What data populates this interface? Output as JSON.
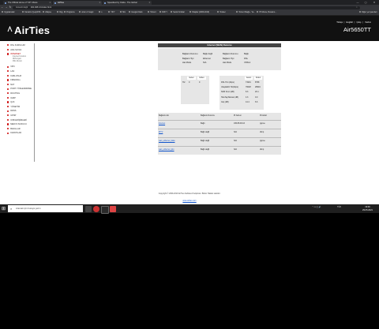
{
  "browser": {
    "tabs": [
      {
        "title": "The Official Home of YIFY Movie",
        "active": false
      },
      {
        "title": "AirTies",
        "active": true
      },
      {
        "title": "Speedtest by Ookla - The Global",
        "active": false
      }
    ],
    "window_controls": {
      "minimize": "—",
      "maximize": "▢",
      "close": "✕"
    },
    "address": {
      "security": "Güvenli değil",
      "url": "192.168.2.1/index.html"
    },
    "bookmarks": [
      "Uygulamalar",
      "Kanalım (Çeşitli Bil...",
      "Allapse",
      "Rpg",
      "Programs",
      "order of magic",
      "s",
      "YIFY",
      "Mix",
      "Google Kitabı",
      "Torrent",
      "DIZI Y",
      "Sezal Kırıkları",
      "Kitaplar (2006-2019)",
      "Toxdec",
      "Torrent Mağa - Ya...",
      "ITI Movie, Bunamo...",
      "Diğer yer işaretleri"
    ]
  },
  "header": {
    "logo": "AirTies",
    "links": [
      "Türkçe",
      "English",
      "Çıkış",
      "Yardım"
    ],
    "model": "Air5650TT"
  },
  "sidebar": {
    "items": [
      {
        "label": "DSL KURULUM",
        "active": false
      },
      {
        "label": "ANA SAYFA",
        "active": false
      },
      {
        "label": "INTERNET",
        "active": true,
        "subs": [
          "Internet Kurulum",
          "DNS Ayarl.",
          "DSL Durum"
        ]
      },
      {
        "label": "VPN",
        "active": false
      },
      {
        "label": "LAN",
        "active": false
      },
      {
        "label": "KABLOSUZ",
        "active": false
      },
      {
        "label": "FIREWALL",
        "active": false
      },
      {
        "label": "NAT",
        "active": false
      },
      {
        "label": "PORT YÖNLENDIRME",
        "active": false
      },
      {
        "label": "ROUTING",
        "active": false
      },
      {
        "label": "IGMP",
        "active": false
      },
      {
        "label": "QoS",
        "active": false
      },
      {
        "label": "YÖNETİM",
        "active": false
      },
      {
        "label": "DDNS",
        "active": false
      },
      {
        "label": "UPNP",
        "active": false
      },
      {
        "label": "USB ERİŞİMLERİ",
        "active": false
      },
      {
        "label": "MEDYA SUNUCU",
        "active": false
      },
      {
        "label": "BAKILLAR",
        "active": false
      },
      {
        "label": "KAPATILAR",
        "active": false
      }
    ]
  },
  "status": {
    "title": "Internet (WAN) Durumu",
    "left": [
      {
        "key": "Bağlantı Durumu",
        "value": "Bağlı değil"
      },
      {
        "key": "Bağlantı Tipi",
        "value": "Ethernet"
      },
      {
        "key": "Hat Modu",
        "value": "N/A"
      }
    ],
    "right": [
      {
        "key": "Bağlantı Durumu",
        "value": "Bağlı"
      },
      {
        "key": "Bağlantı Tipi",
        "value": "DSL"
      },
      {
        "key": "Hat Modu",
        "value": "VDSL2"
      }
    ]
  },
  "small_table": {
    "headers": [
      "Gelen",
      "Giden"
    ],
    "rows": [
      {
        "label": "Hız",
        "values": [
          "0",
          "0"
        ]
      }
    ]
  },
  "dsl_table": {
    "headers": [
      "Gelen",
      "Giden"
    ],
    "rows": [
      {
        "label": "DSL Hızı (kbps)",
        "values": [
          "71901",
          "8798"
        ]
      },
      {
        "label": "Ulaşılabilir Hız(kbps)",
        "values": [
          "76628",
          "28994"
        ]
      },
      {
        "label": "SNR Sınırı (dB)",
        "values": [
          "8.3",
          "29.1"
        ]
      },
      {
        "label": "Hat Zayıflaması (dB)",
        "values": [
          "4.3",
          "0.0"
        ]
      },
      {
        "label": "Güç (dB)",
        "values": [
          "14.4",
          "6.6"
        ]
      }
    ]
  },
  "connections": {
    "headers": [
      "Bağlantı Adı",
      "Bağlantı Durumu",
      "IP Adresi",
      "Protokol"
    ],
    "rows": [
      {
        "name": "Internet",
        "status": "Bağlı",
        "ip": "195.88.93.16",
        "protocol": "pppoe"
      },
      {
        "name": "IPTV",
        "status": "Bağlı değil",
        "ip": "N/A",
        "protocol": "dhcp"
      },
      {
        "name": "wan_ethernet_data",
        "status": "Bağlı değil",
        "ip": "N/A",
        "protocol": "pppoe"
      },
      {
        "name": "wan_ethernet_iptv",
        "status": "Bağlı değil",
        "ip": "N/A",
        "protocol": "dhcp"
      }
    ]
  },
  "footer": {
    "copyright": "Copyright © 2009-2019 AirTies Kablosuz İletişimler. Bütün Hakları saklıdır.",
    "link": "www.airties.com"
  },
  "taskbar": {
    "search_placeholder": "Aramak için buraya yazın",
    "time": "19:46",
    "date": "29.05.2021",
    "lang": "TÜR"
  }
}
